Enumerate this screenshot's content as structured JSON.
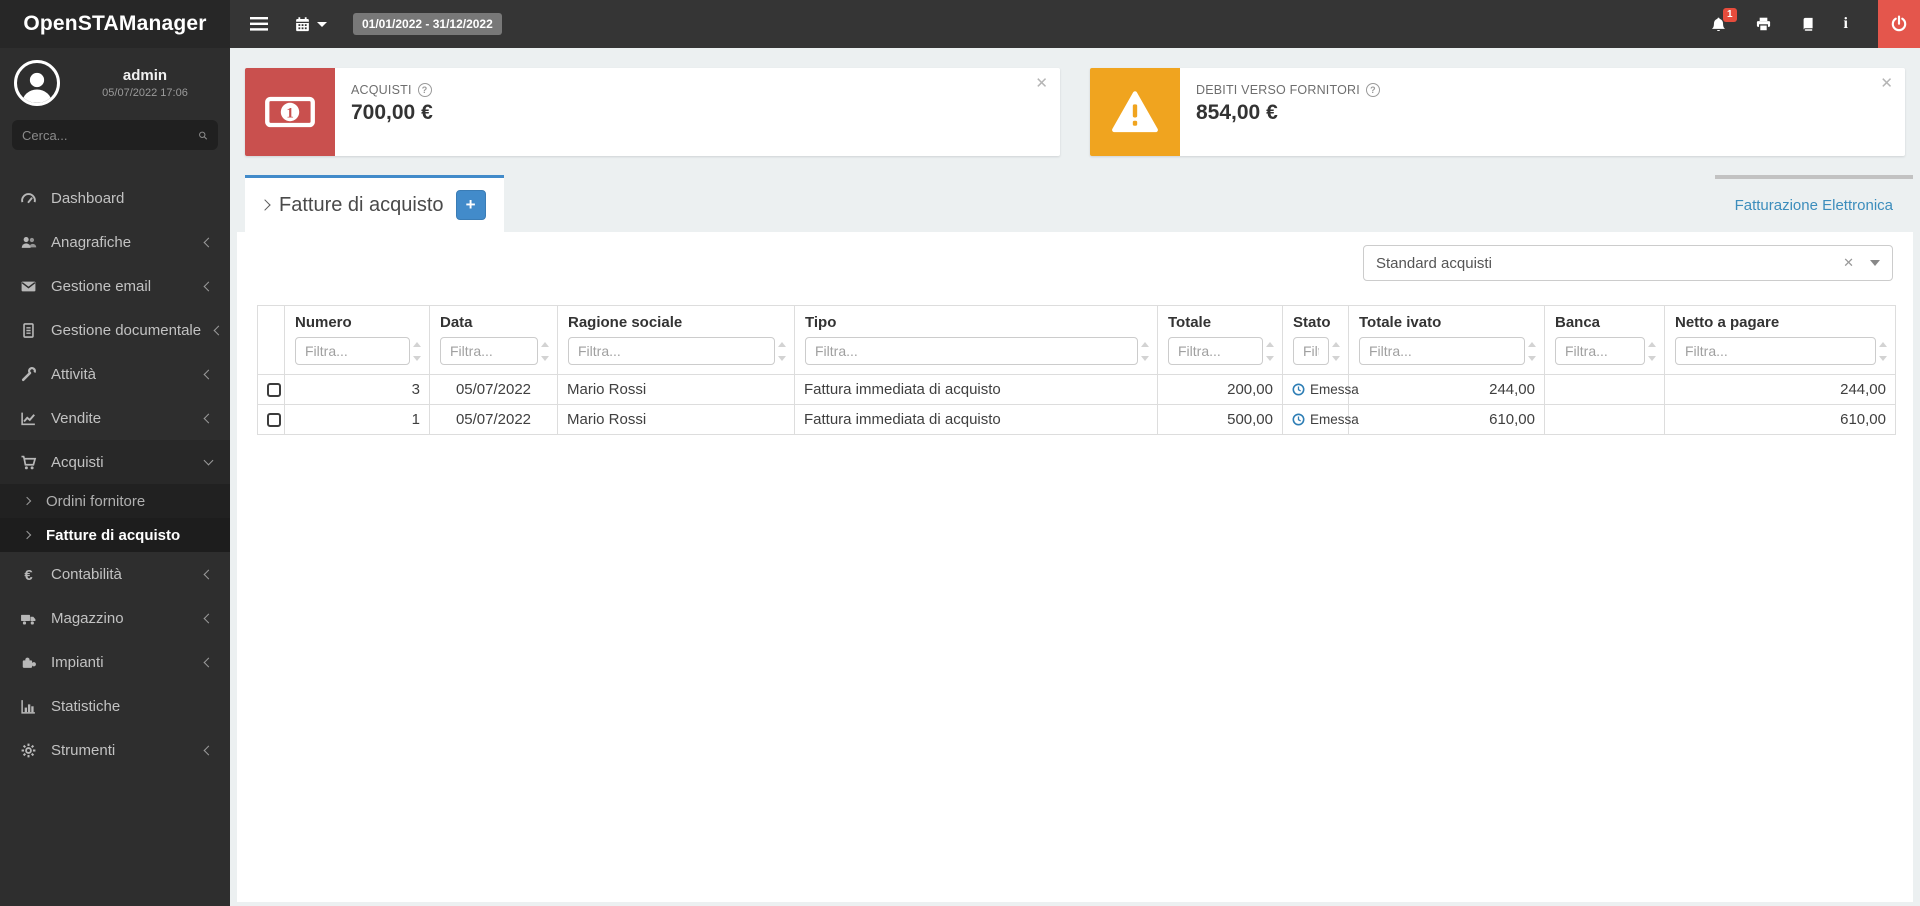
{
  "app": {
    "title": "OpenSTAManager"
  },
  "topbar": {
    "date_range": "01/01/2022 - 31/12/2022",
    "notification_count": "1"
  },
  "sidebar": {
    "user": {
      "name": "admin",
      "datetime": "05/07/2022 17:06"
    },
    "search_placeholder": "Cerca...",
    "items": [
      {
        "label": "Dashboard",
        "icon": "gauge-icon",
        "chevron": "none"
      },
      {
        "label": "Anagrafiche",
        "icon": "users-icon",
        "chevron": "left"
      },
      {
        "label": "Gestione email",
        "icon": "envelope-icon",
        "chevron": "left"
      },
      {
        "label": "Gestione documentale",
        "icon": "document-icon",
        "chevron": "left"
      },
      {
        "label": "Attività",
        "icon": "wrench-icon",
        "chevron": "left"
      },
      {
        "label": "Vendite",
        "icon": "chart-line-icon",
        "chevron": "left"
      },
      {
        "label": "Acquisti",
        "icon": "cart-icon",
        "chevron": "down",
        "open": true
      },
      {
        "label": "Contabilità",
        "icon": "euro-icon",
        "chevron": "left"
      },
      {
        "label": "Magazzino",
        "icon": "truck-icon",
        "chevron": "left"
      },
      {
        "label": "Impianti",
        "icon": "machine-icon",
        "chevron": "left"
      },
      {
        "label": "Statistiche",
        "icon": "bar-chart-icon",
        "chevron": "none"
      },
      {
        "label": "Strumenti",
        "icon": "gear-icon",
        "chevron": "left"
      }
    ],
    "submenu": [
      {
        "label": "Ordini fornitore",
        "active": false
      },
      {
        "label": "Fatture di acquisto",
        "active": true
      }
    ]
  },
  "cards": [
    {
      "label": "ACQUISTI",
      "value": "700,00 €",
      "icon": "money-bill-icon",
      "color": "#c9504e"
    },
    {
      "label": "DEBITI VERSO FORNITORI",
      "value": "854,00 €",
      "icon": "warning-icon",
      "color": "#f0a41f"
    }
  ],
  "tabs": {
    "active_title": "Fatture di acquisto",
    "add_label": "+",
    "right_link": "Fatturazione Elettronica"
  },
  "filter_select": {
    "value": "Standard acquisti"
  },
  "table": {
    "columns": [
      "Numero",
      "Data",
      "Ragione sociale",
      "Tipo",
      "Totale",
      "Stato",
      "Totale ivato",
      "Banca",
      "Netto a pagare"
    ],
    "filter_placeholder": "Filtra...",
    "rows": [
      {
        "numero": "3",
        "data": "05/07/2022",
        "ragione_sociale": "Mario Rossi",
        "tipo": "Fattura immediata di acquisto",
        "totale": "200,00",
        "stato": "Emessa",
        "totale_ivato": "244,00",
        "banca": "",
        "netto_a_pagare": "244,00"
      },
      {
        "numero": "1",
        "data": "05/07/2022",
        "ragione_sociale": "Mario Rossi",
        "tipo": "Fattura immediata di acquisto",
        "totale": "500,00",
        "stato": "Emessa",
        "totale_ivato": "610,00",
        "banca": "",
        "netto_a_pagare": "610,00"
      }
    ]
  },
  "colors": {
    "accent_blue": "#428bca",
    "link_blue": "#3c8dbc",
    "card_red": "#c9504e",
    "card_orange": "#f0a41f",
    "power_red": "#e4564c",
    "badge_red": "#e74c3c",
    "status_clock_blue": "#2e7eb5",
    "sidebar_bg": "#2e2e2e",
    "topbar_bg": "#353535"
  }
}
